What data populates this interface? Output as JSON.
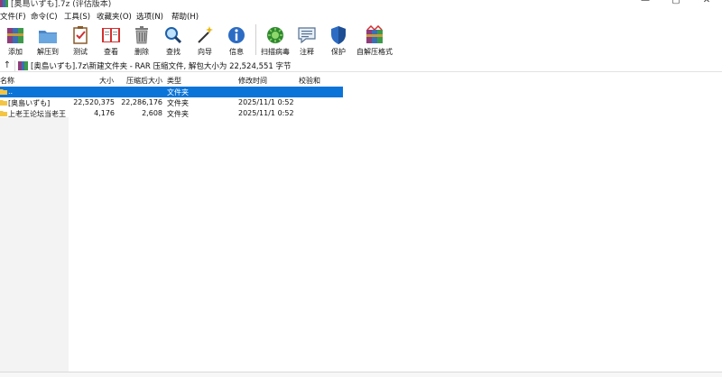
{
  "window": {
    "title": "[奥島いずも].7z (评估版本)",
    "controls": [
      "—",
      "▢",
      "✕"
    ]
  },
  "menu": [
    {
      "label": "文件(F)"
    },
    {
      "label": "命令(C)"
    },
    {
      "label": "工具(S)"
    },
    {
      "label": "收藏夹(O)"
    },
    {
      "label": "选项(N)"
    },
    {
      "label": "帮助(H)"
    }
  ],
  "toolbar": [
    {
      "label": "添加",
      "icon": "add-icon"
    },
    {
      "label": "解压到",
      "icon": "extract-folder-icon"
    },
    {
      "label": "测试",
      "icon": "test-clipboard-icon"
    },
    {
      "label": "查看",
      "icon": "view-book-icon"
    },
    {
      "label": "删除",
      "icon": "trash-icon"
    },
    {
      "label": "查找",
      "icon": "find-magnifier-icon"
    },
    {
      "label": "向导",
      "icon": "wizard-wand-icon"
    },
    {
      "label": "信息",
      "icon": "info-icon"
    },
    {
      "label": "扫描病毒",
      "icon": "virus-scan-icon"
    },
    {
      "label": "注释",
      "icon": "comment-icon"
    },
    {
      "label": "保护",
      "icon": "shield-icon"
    },
    {
      "label": "自解压格式",
      "icon": "sfx-archive-icon"
    }
  ],
  "address": {
    "up_icon": "up-arrow-icon",
    "path": "[奥島いずも].7z\\新建文件夹 - RAR 压缩文件, 解包大小为 22,524,551 字节"
  },
  "columns": {
    "name": "名称",
    "size": "大小",
    "packed": "压缩后大小",
    "type": "类型",
    "modified": "修改时间",
    "checksum": "校验和"
  },
  "rows": [
    {
      "name": "..",
      "size": "",
      "packed": "",
      "type": "文件夹",
      "modified": "",
      "selected": true
    },
    {
      "name": "[奥島いずも]",
      "size": "22,520,375",
      "packed": "22,286,176",
      "type": "文件夹",
      "modified": "2025/11/1 0:52",
      "selected": false
    },
    {
      "name": "上老王论坛当老王",
      "size": "4,176",
      "packed": "2,608",
      "type": "文件夹",
      "modified": "2025/11/1 0:52",
      "selected": false
    }
  ],
  "colors": {
    "selection": "#0a74d8",
    "folder": "#f4c542"
  }
}
